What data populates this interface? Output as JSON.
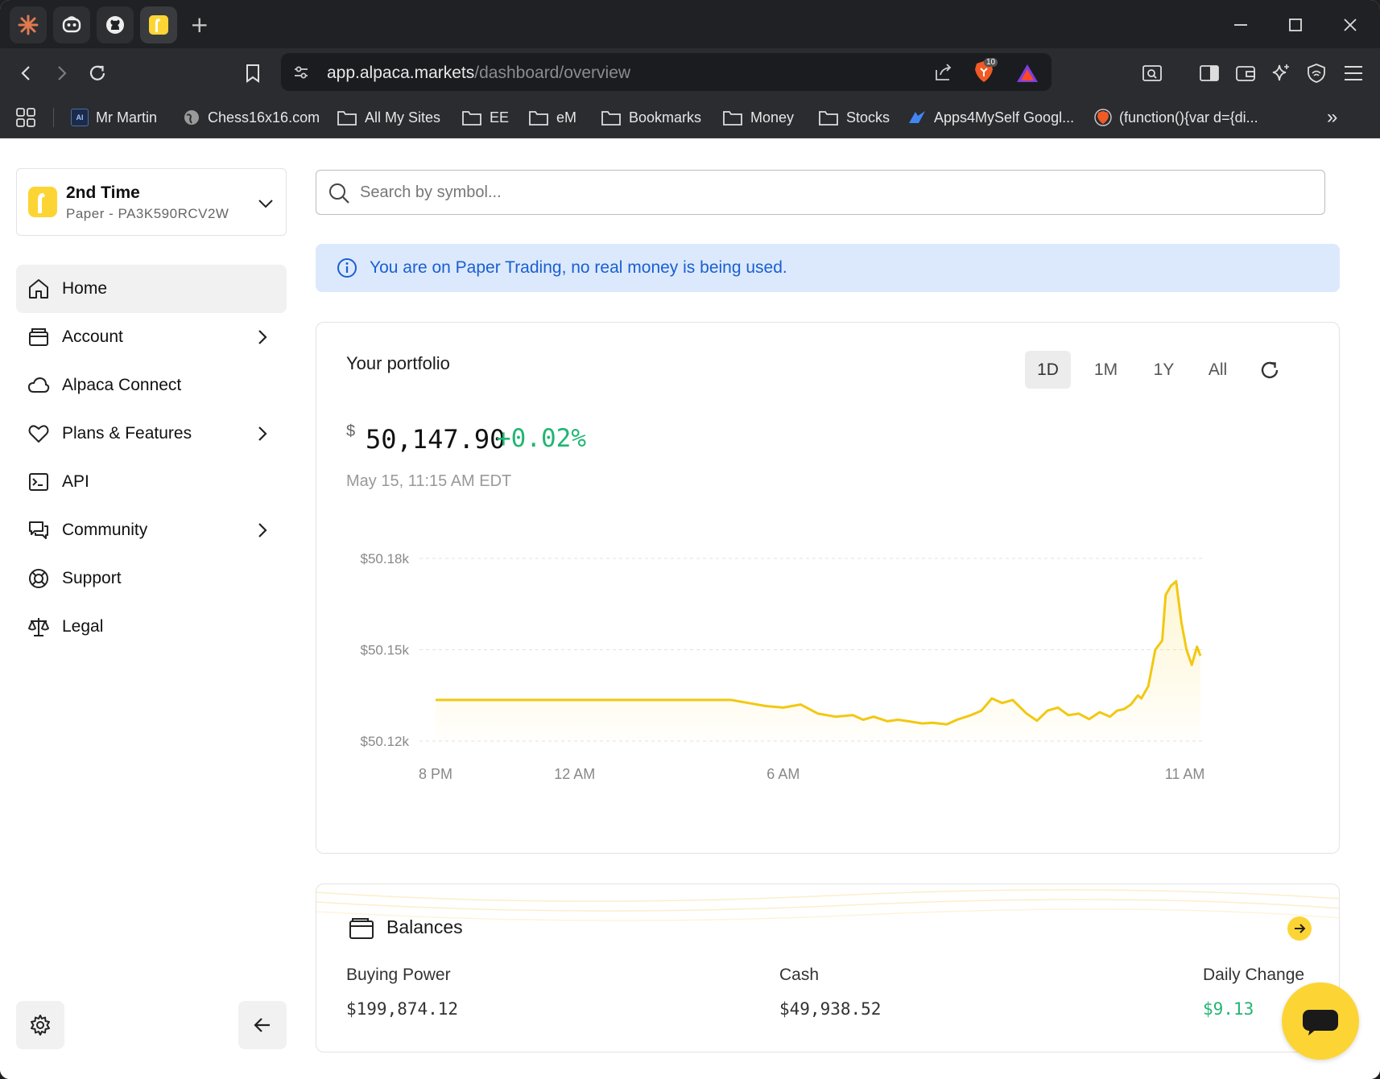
{
  "browser": {
    "url_host": "app.alpaca.markets",
    "url_path": "/dashboard/overview",
    "shield_badge": "10",
    "bookmarks": [
      "Mr Martin",
      "Chess16x16.com",
      "All My Sites",
      "EE",
      "eM",
      "Bookmarks",
      "Money",
      "Stocks",
      "Apps4MySelf Googl...",
      "(function(){var d={di..."
    ],
    "more_bookmarks": "»"
  },
  "account": {
    "name": "2nd Time",
    "type": "Paper",
    "separator": "-",
    "id": "PA3K590RCV2W"
  },
  "sidebar": {
    "items": [
      {
        "label": "Home",
        "icon": "home-icon"
      },
      {
        "label": "Account",
        "icon": "wallet-icon"
      },
      {
        "label": "Alpaca Connect",
        "icon": "cloud-icon"
      },
      {
        "label": "Plans & Features",
        "icon": "heart-icon"
      },
      {
        "label": "API",
        "icon": "terminal-icon"
      },
      {
        "label": "Community",
        "icon": "chat-icon"
      },
      {
        "label": "Support",
        "icon": "lifebuoy-icon"
      },
      {
        "label": "Legal",
        "icon": "scales-icon"
      }
    ]
  },
  "search": {
    "placeholder": "Search by symbol..."
  },
  "banner": {
    "text": "You are on Paper Trading, no real money is being used."
  },
  "portfolio": {
    "title": "Your portfolio",
    "ranges": [
      "1D",
      "1M",
      "1Y",
      "All"
    ],
    "selected_range": "1D",
    "currency_symbol": "$",
    "value": "50,147.90",
    "change": "+0.02%",
    "timestamp": "May 15, 11:15 AM EDT"
  },
  "chart_data": {
    "type": "area",
    "title": "",
    "xlabel": "",
    "ylabel": "",
    "x_tick_labels": [
      "8 PM",
      "12 AM",
      "6 AM",
      "11 AM"
    ],
    "y_tick_labels": [
      "$50.18k",
      "$50.15k",
      "$50.12k"
    ],
    "ylim": [
      50120,
      50180
    ],
    "grid": true,
    "color": "#f2c811",
    "series": [
      {
        "x_hours": [
          20,
          21,
          22,
          23,
          24,
          25,
          26,
          27,
          28.5,
          29,
          29.5,
          30,
          30.5,
          31,
          31.5,
          32,
          32.3,
          32.6,
          33,
          33.3,
          33.6,
          34,
          34.3,
          34.7,
          35,
          35.4,
          35.7,
          36,
          36.3,
          36.6,
          37,
          37.3,
          37.6,
          37.9,
          38.2,
          38.5,
          38.8,
          39.1,
          39.4,
          39.6,
          39.8,
          40,
          40.2,
          40.3,
          40.5,
          40.7,
          40.9,
          41,
          41.15,
          41.3,
          41.45,
          41.6,
          41.75,
          41.9,
          42
        ],
        "values": [
          50133.5,
          50133.5,
          50133.5,
          50133.5,
          50133.5,
          50133.5,
          50133.5,
          50133.5,
          50133.5,
          50132.5,
          50131.5,
          50131,
          50132,
          50129,
          50128,
          50128.5,
          50127,
          50128,
          50126.5,
          50127,
          50126.5,
          50125.8,
          50126,
          50125.5,
          50127,
          50128.5,
          50130,
          50134,
          50132.5,
          50133.5,
          50129,
          50126.7,
          50130,
          50131,
          50128.5,
          50129,
          50127.2,
          50129.5,
          50128,
          50130,
          50130.5,
          50132,
          50135,
          50134,
          50138,
          50150,
          50153,
          50168,
          50171,
          50172.5,
          50159,
          50150,
          50145,
          50151,
          50148
        ]
      }
    ]
  },
  "balances": {
    "title": "Balances",
    "columns": [
      {
        "label": "Buying Power",
        "value": "$199,874.12"
      },
      {
        "label": "Cash",
        "value": "$49,938.52"
      },
      {
        "label": "Daily Change",
        "value": "$9.13"
      }
    ],
    "positive_color": "#22b573"
  },
  "colors": {
    "brand": "#fcd535",
    "line": "#f2c811",
    "banner_bg": "#dce9fd",
    "banner_text": "#1a5fd0"
  }
}
